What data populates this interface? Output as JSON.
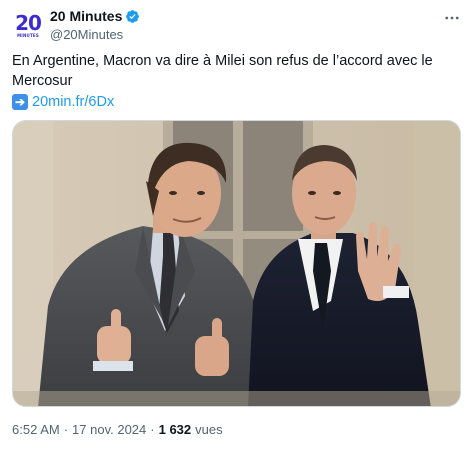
{
  "author": {
    "logo_text": "20",
    "logo_subtext": "MINUTES",
    "display_name": "20 Minutes",
    "handle": "@20Minutes"
  },
  "tweet": {
    "text": "En Argentine, Macron va dire à Milei son refus de l’accord avec le Mercosur",
    "link_icon": "arrow-right-emoji-icon",
    "link_text": "20min.fr/6Dx"
  },
  "meta": {
    "time": "6:52 AM",
    "separator": "·",
    "date": "17 nov. 2024",
    "separator2": "·",
    "views_count": "1 632",
    "views_label": "vues"
  },
  "colors": {
    "brand": "#3b2bd0",
    "verified": "#1d9bf0",
    "link": "#1d9bf0",
    "secondary_text": "#536471"
  },
  "icons": [
    "verified-badge-icon",
    "more-options-icon",
    "arrow-right-emoji-icon"
  ]
}
